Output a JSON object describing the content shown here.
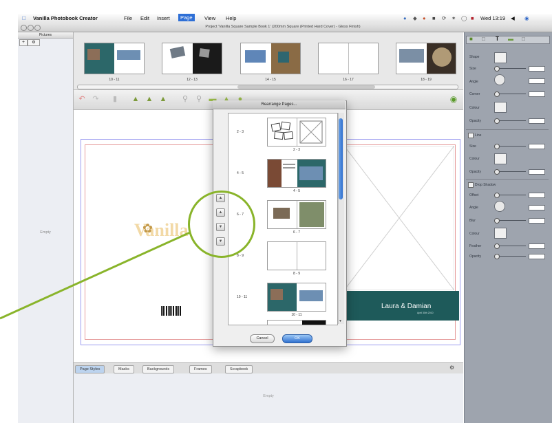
{
  "menubar": {
    "app_name": "Vanilla Photobook Creator",
    "menus": [
      "File",
      "Edit",
      "Insert",
      "Page",
      "View",
      "Help"
    ],
    "active_menu": "Page",
    "clock": "Wed 13:19"
  },
  "window": {
    "title": "Project 'Vanilla Square Sample Book 1' (200mm Square (Printed Hard Cover) - Gloss Finish)"
  },
  "left_panel": {
    "header": "Pictures",
    "empty_label": "Empty"
  },
  "pictures_strip": {
    "thumbnails": [
      {
        "label": "10 - 11"
      },
      {
        "label": "12 - 13"
      },
      {
        "label": "14 - 15"
      },
      {
        "label": "16 - 17"
      },
      {
        "label": "18 - 19"
      }
    ]
  },
  "canvas": {
    "logo_text": "Vanilla",
    "cover_names": "Laura & Damian",
    "cover_subtitle": "April 30th 2010"
  },
  "dialog": {
    "title": "Rearrange Pages...",
    "pages": [
      {
        "range": "2 - 3",
        "caption": "2 - 3"
      },
      {
        "range": "4 - 5",
        "caption": "4 - 5"
      },
      {
        "range": "6 - 7",
        "caption": "6 - 7"
      },
      {
        "range": "8 - 9",
        "caption": "8 - 9"
      },
      {
        "range": "10 - 11",
        "caption": "10 - 11"
      }
    ],
    "cancel_label": "Cancel",
    "ok_label": "OK"
  },
  "bottom_tabs": [
    "Page Styles",
    "Masks",
    "Backgrounds",
    "Frames",
    "Scrapbook"
  ],
  "bottom_panel": {
    "empty_label": "Empty"
  },
  "right_panel": {
    "sections": [
      {
        "label": "Shape"
      },
      {
        "label": "Size"
      },
      {
        "label": "Angle"
      },
      {
        "label": "Corner"
      },
      {
        "label": "Colour"
      },
      {
        "label": "Opacity"
      }
    ],
    "line_section": {
      "checkbox_label": "Line",
      "rows": [
        "Size",
        "Colour",
        "Opacity"
      ]
    },
    "shadow_section": {
      "checkbox_label": "Drop Shadow",
      "rows": [
        "Offset",
        "Angle",
        "Blur",
        "Colour",
        "Feather",
        "Opacity"
      ]
    }
  },
  "colors": {
    "callout": "#89b42a",
    "cover_teal": "#1e5a5a",
    "scroll_blue": "#2f70cf",
    "right_panel": "#9ea4ae"
  }
}
